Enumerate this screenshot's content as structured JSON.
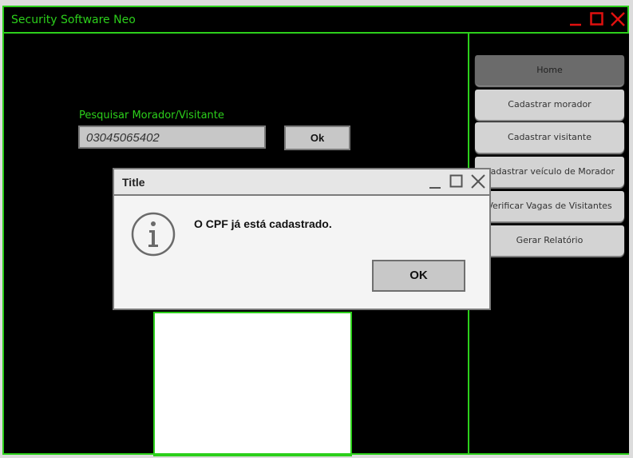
{
  "window": {
    "title": "Security Software Neo"
  },
  "search": {
    "label": "Pesquisar Morador/Visitante",
    "value": "03045065402",
    "button_label": "Ok"
  },
  "sidebar": {
    "items": [
      {
        "label": "Home"
      },
      {
        "label": "Cadastrar morador"
      },
      {
        "label": "Cadastrar visitante"
      },
      {
        "label": "Cadastrar veículo de Morador"
      },
      {
        "label": "Verificar Vagas de Visitantes"
      },
      {
        "label": "Gerar Relatório"
      }
    ]
  },
  "dialog": {
    "title": "Title",
    "message": "O CPF já está cadastrado.",
    "ok_label": "OK",
    "icon": "info-icon"
  },
  "colors": {
    "accent": "#2ccf1b",
    "window_controls": "#e0100f"
  }
}
